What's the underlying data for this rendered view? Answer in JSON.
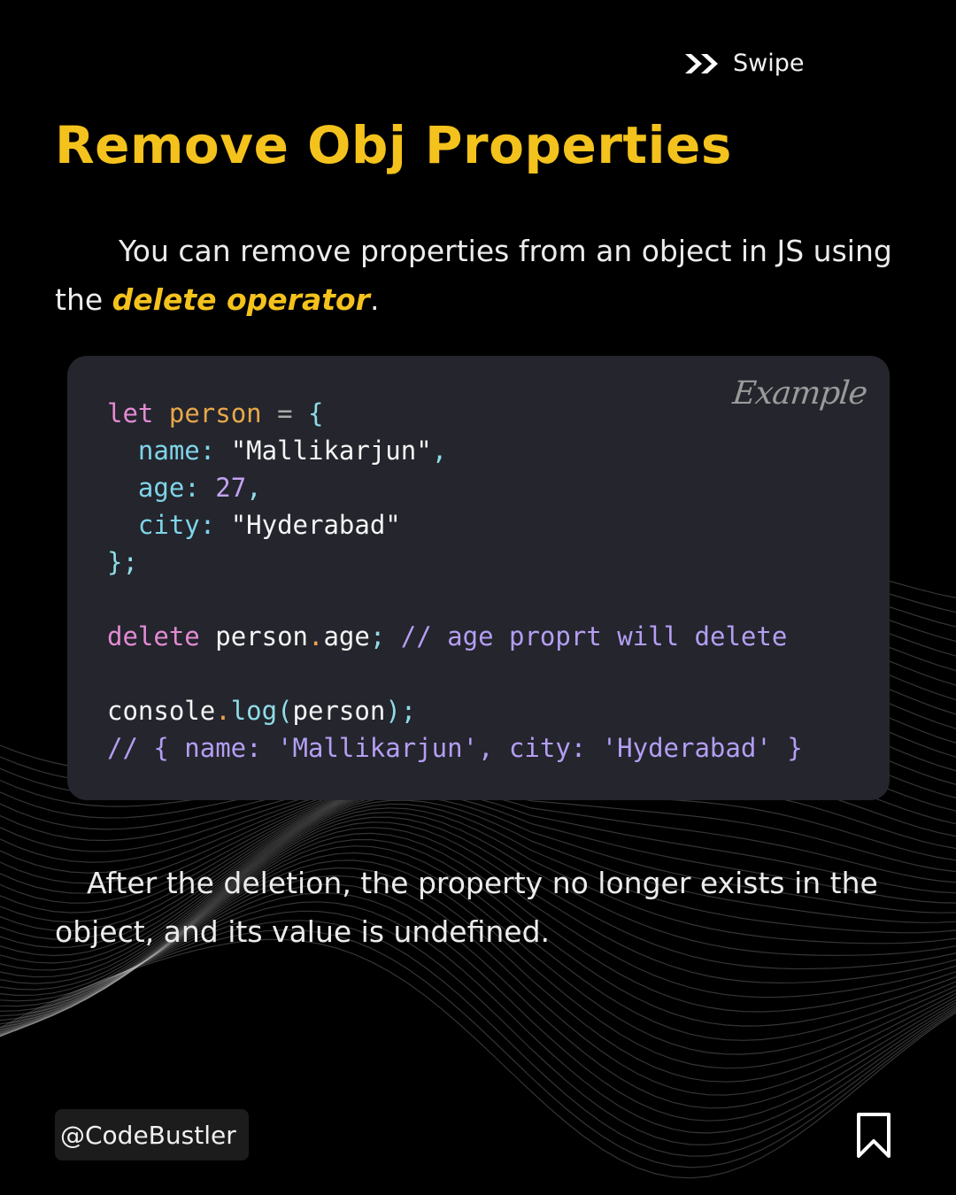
{
  "swipe": {
    "label": "Swipe",
    "icon": "double-chevron-right-icon"
  },
  "title": "Remove Obj Properties",
  "intro": {
    "before": "You can remove properties from an object in JS using the ",
    "highlight": "delete operator",
    "after": "."
  },
  "code_card": {
    "tag": "Example",
    "lines": [
      "let person = {",
      "  name: \"Mallikarjun\",",
      "  age: 27,",
      "  city: \"Hyderabad\"",
      "};",
      "",
      "delete person.age; // age proprt will delete",
      "",
      "console.log(person);",
      "// { name: 'Mallikarjun', city: 'Hyderabad' }"
    ]
  },
  "outro": "After the deletion, the property no longer exists in the object, and its value is undefined.",
  "footer": {
    "handle": "@CodeBustler",
    "bookmark_icon": "bookmark-icon"
  },
  "colors": {
    "accent": "#f4c21c",
    "background": "#000000",
    "code_bg": "#24252d"
  }
}
